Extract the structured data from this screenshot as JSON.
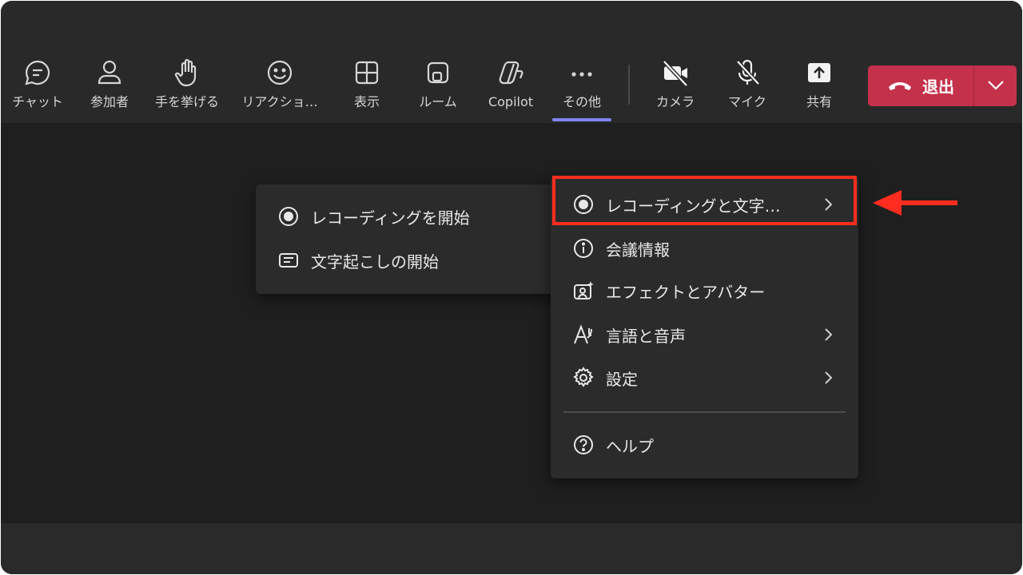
{
  "toolbar": {
    "items": [
      {
        "label": "チャット",
        "icon": "chat-icon"
      },
      {
        "label": "参加者",
        "icon": "people-icon"
      },
      {
        "label": "手を挙げる",
        "icon": "raise-hand-icon"
      },
      {
        "label": "リアクショ…",
        "icon": "smiley-icon"
      },
      {
        "label": "表示",
        "icon": "view-grid-icon"
      },
      {
        "label": "ルーム",
        "icon": "rooms-icon"
      },
      {
        "label": "Copilot",
        "icon": "copilot-icon"
      },
      {
        "label": "その他",
        "icon": "more-icon"
      },
      {
        "label": "カメラ",
        "icon": "camera-off-icon"
      },
      {
        "label": "マイク",
        "icon": "mic-off-icon"
      },
      {
        "label": "共有",
        "icon": "share-icon"
      }
    ],
    "leave_label": "退出"
  },
  "more_menu": {
    "items": [
      {
        "label": "レコーディングと文字…",
        "icon": "record-icon",
        "submenu": true
      },
      {
        "label": "会議情報",
        "icon": "info-icon",
        "submenu": false
      },
      {
        "label": "エフェクトとアバター",
        "icon": "effects-icon",
        "submenu": false
      },
      {
        "label": "言語と音声",
        "icon": "language-icon",
        "submenu": true
      },
      {
        "label": "設定",
        "icon": "gear-icon",
        "submenu": true
      },
      {
        "label": "ヘルプ",
        "icon": "help-icon",
        "submenu": false
      }
    ]
  },
  "recording_submenu": {
    "items": [
      {
        "label": "レコーディングを開始",
        "icon": "record-icon"
      },
      {
        "label": "文字起こしの開始",
        "icon": "transcript-icon"
      }
    ]
  },
  "colors": {
    "leave_button": "#c4314b",
    "active_indicator": "#7f85f5",
    "annotation": "#ff2d1f"
  }
}
